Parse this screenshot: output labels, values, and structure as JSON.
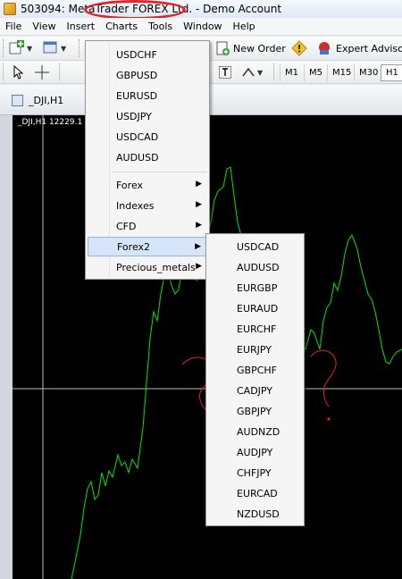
{
  "titlebar": {
    "title": "503094: MetaTrader FOREX Ltd. - Demo Account"
  },
  "menubar": {
    "items": [
      "File",
      "View",
      "Insert",
      "Charts",
      "Tools",
      "Window",
      "Help"
    ]
  },
  "toolbar1": {
    "new_order": "New Order",
    "expert_advisors": "Expert Advisors"
  },
  "timeframes": [
    "M1",
    "M5",
    "M15",
    "M30",
    "H1"
  ],
  "chart": {
    "tab_title": "_DJI,H1",
    "label": "_DJI,H1  12229.1"
  },
  "symbols_menu": {
    "symbols": [
      "USDCHF",
      "GBPUSD",
      "EURUSD",
      "USDJPY",
      "USDCAD",
      "AUDUSD"
    ],
    "groups": [
      "Forex",
      "Indexes",
      "CFD",
      "Forex2",
      "Precious_metals"
    ]
  },
  "forex2_menu": {
    "symbols": [
      "USDCAD",
      "AUDUSD",
      "EURGBP",
      "EURAUD",
      "EURCHF",
      "EURJPY",
      "GBPCHF",
      "CADJPY",
      "GBPJPY",
      "AUDNZD",
      "AUDJPY",
      "CHFJPY",
      "EURCAD",
      "NZDUSD"
    ]
  },
  "colors": {
    "chart_bg": "#000000",
    "price_line": "#00e600",
    "annotation": "#e0202a",
    "highlight": "#d6e6f8"
  }
}
